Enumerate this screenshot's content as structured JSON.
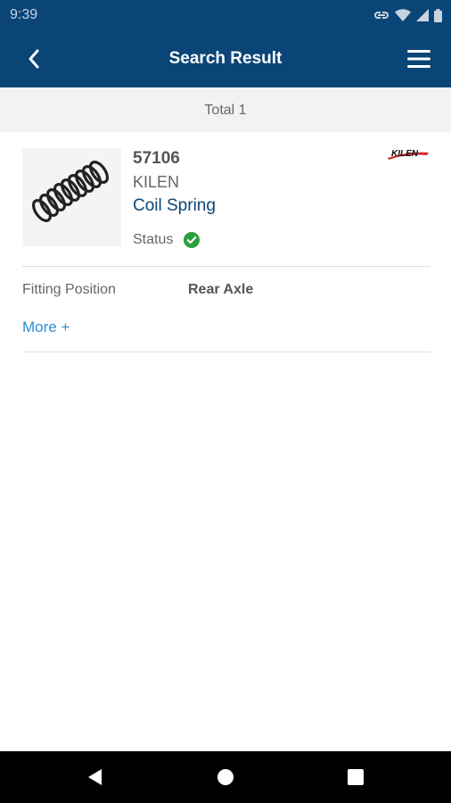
{
  "status_bar": {
    "time": "9:39"
  },
  "app_bar": {
    "title": "Search Result"
  },
  "summary": {
    "total_text": "Total 1"
  },
  "result": {
    "part_number": "57106",
    "brand": "KILEN",
    "product_name": "Coil Spring",
    "status_label": "Status",
    "status": "ok",
    "brand_logo_text": "KILEN",
    "specs": [
      {
        "label": "Fitting Position",
        "value": "Rear Axle"
      }
    ],
    "more_label": "More +"
  },
  "icons": {
    "back": "chevron-left-icon",
    "menu": "hamburger-menu-icon",
    "status": "check-circle-icon"
  },
  "colors": {
    "primary": "#0b4578",
    "link": "#2b8fd6",
    "status_ok": "#2e9e3e",
    "brand_red": "#d2232a"
  }
}
